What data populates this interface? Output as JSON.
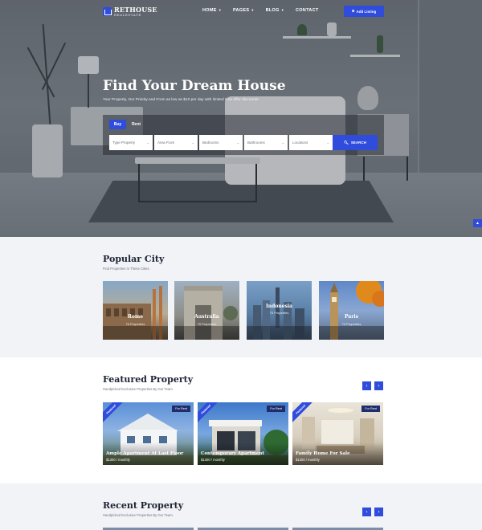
{
  "brand": {
    "name": "RETHOUSE",
    "tagline": "REALESTATE",
    "accent": "#2f4cdc"
  },
  "nav": {
    "items": [
      {
        "label": "HOME",
        "dropdown": true
      },
      {
        "label": "PAGES",
        "dropdown": true
      },
      {
        "label": "BLOG",
        "dropdown": true
      },
      {
        "label": "CONTACT",
        "dropdown": false
      }
    ],
    "add_listing": "Add Listing"
  },
  "hero": {
    "title": "Find Your Dream House",
    "subtitle": "Your Property, Our Priority and From as low as $10 per day with limited time offer discounts"
  },
  "search": {
    "tabs": [
      "Buy",
      "Rent"
    ],
    "active_tab": "Buy",
    "fields": [
      {
        "placeholder": "Type Property"
      },
      {
        "placeholder": "Area From"
      },
      {
        "placeholder": "Bedrooms"
      },
      {
        "placeholder": "Bathrooms"
      },
      {
        "placeholder": "Locations"
      }
    ],
    "button": "SEARCH"
  },
  "popular_city": {
    "title": "Popular City",
    "subtitle": "Find Properties In These Cities.",
    "cities": [
      {
        "name": "Rome",
        "count": "70 Properties"
      },
      {
        "name": "Australia",
        "count": "70 Properties"
      },
      {
        "name": "Indonesia",
        "count": "70 Properties"
      },
      {
        "name": "Paris",
        "count": "70 Properties"
      }
    ]
  },
  "featured": {
    "title": "Featured Property",
    "subtitle": "Handpicked Exclusive Properties By Our Team.",
    "properties": [
      {
        "ribbon": "Featured",
        "badge": "For Rent",
        "title": "Ample Apartment At Last Floor",
        "price": "$1300 / monthly"
      },
      {
        "ribbon": "Featured",
        "badge": "For Rent",
        "title": "Contemporary Apartment",
        "price": "$1300 / monthly"
      },
      {
        "ribbon": "Featured",
        "badge": "For Rent",
        "title": "Family Home For Sale",
        "price": "$1300 / monthly"
      }
    ]
  },
  "recent": {
    "title": "Recent Property",
    "subtitle": "Handpicked Exclusive Properties By Our Team."
  }
}
